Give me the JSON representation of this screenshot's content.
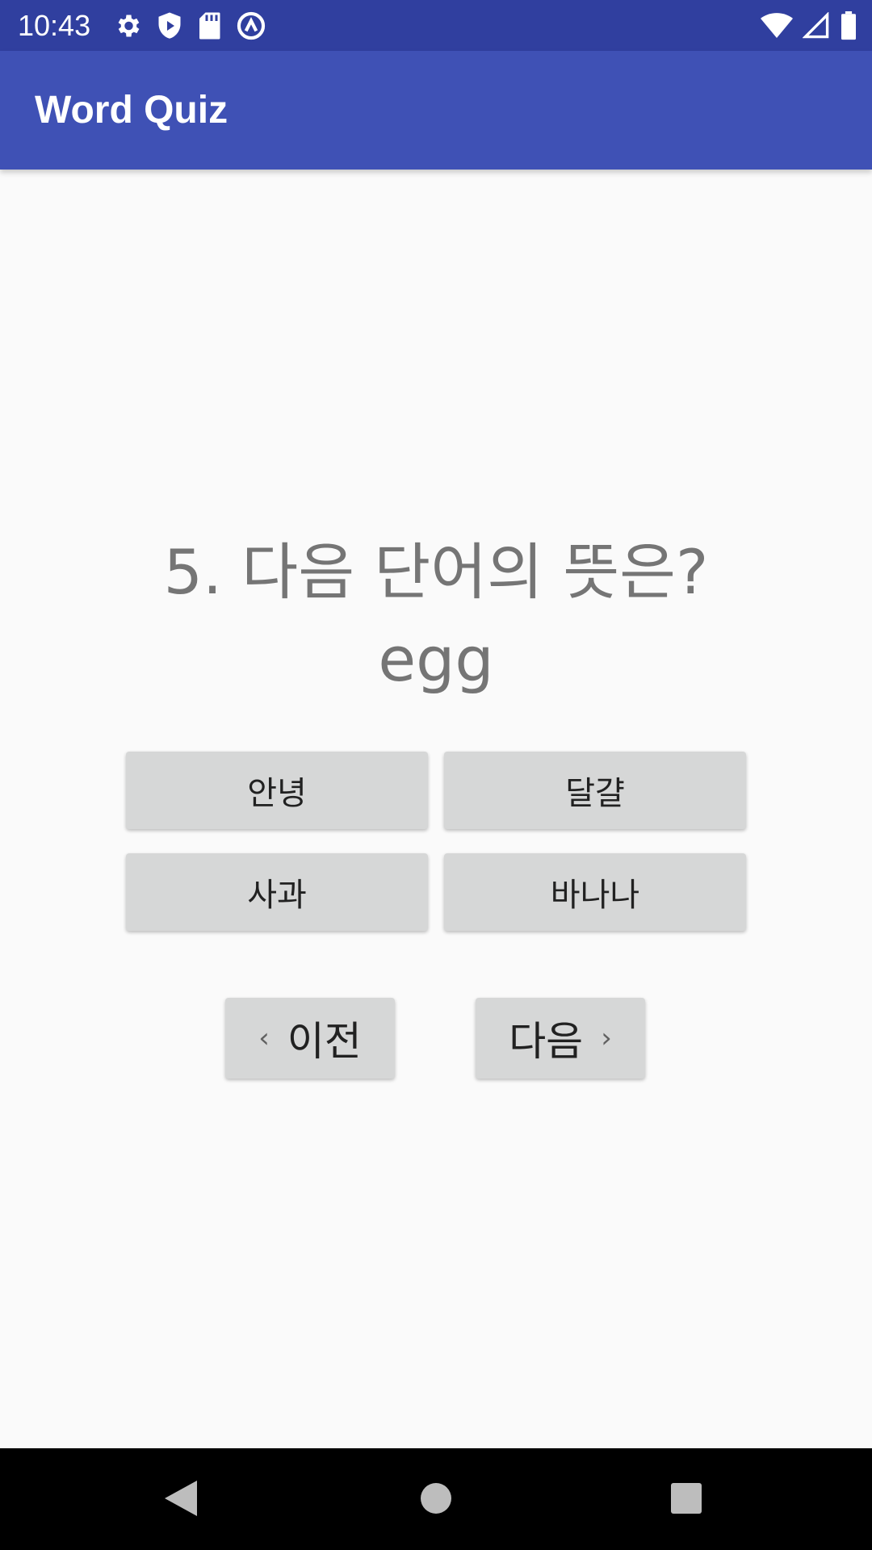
{
  "status_bar": {
    "time": "10:43",
    "left_icons": [
      "settings-icon",
      "shield-play-icon",
      "sd-card-icon",
      "sync-circle-icon"
    ],
    "right_icons": [
      "wifi-icon",
      "cell-signal-icon",
      "battery-icon"
    ]
  },
  "app_bar": {
    "title": "Word Quiz"
  },
  "question": {
    "prompt": "5. 다음 단어의 뜻은?",
    "word": "egg"
  },
  "answers": [
    {
      "label": "안녕"
    },
    {
      "label": "달걀"
    },
    {
      "label": "사과"
    },
    {
      "label": "바나나"
    }
  ],
  "navigation": {
    "prev_label": "이전",
    "next_label": "다음",
    "prev_chevron": "‹",
    "next_chevron": "›"
  },
  "colors": {
    "status_bar": "#303f9f",
    "app_bar": "#3f51b5",
    "background": "#fafafa",
    "button": "#d6d7d7",
    "question_text": "#757575"
  }
}
